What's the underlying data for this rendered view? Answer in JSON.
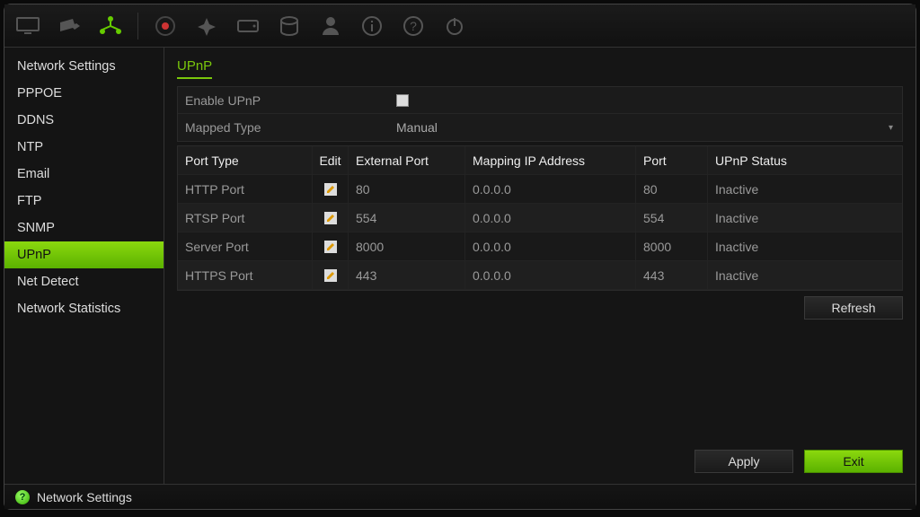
{
  "toolbar_icons": [
    "monitor",
    "camera",
    "network",
    "record",
    "alarm",
    "drive",
    "hdd",
    "user",
    "info",
    "help",
    "power"
  ],
  "sidebar": {
    "items": [
      {
        "label": "Network Settings"
      },
      {
        "label": "PPPOE"
      },
      {
        "label": "DDNS"
      },
      {
        "label": "NTP"
      },
      {
        "label": "Email"
      },
      {
        "label": "FTP"
      },
      {
        "label": "SNMP"
      },
      {
        "label": "UPnP"
      },
      {
        "label": "Net Detect"
      },
      {
        "label": "Network Statistics"
      }
    ],
    "active_index": 7
  },
  "page": {
    "title": "UPnP",
    "enable_label": "Enable UPnP",
    "enable_checked": false,
    "mapped_type_label": "Mapped Type",
    "mapped_type_value": "Manual"
  },
  "table": {
    "headers": {
      "port_type": "Port Type",
      "edit": "Edit",
      "external_port": "External Port",
      "mapping_ip": "Mapping IP Address",
      "port": "Port",
      "status": "UPnP Status"
    },
    "rows": [
      {
        "port_type": "HTTP Port",
        "external_port": "80",
        "mapping_ip": "0.0.0.0",
        "port": "80",
        "status": "Inactive"
      },
      {
        "port_type": "RTSP Port",
        "external_port": "554",
        "mapping_ip": "0.0.0.0",
        "port": "554",
        "status": "Inactive"
      },
      {
        "port_type": "Server Port",
        "external_port": "8000",
        "mapping_ip": "0.0.0.0",
        "port": "8000",
        "status": "Inactive"
      },
      {
        "port_type": "HTTPS Port",
        "external_port": "443",
        "mapping_ip": "0.0.0.0",
        "port": "443",
        "status": "Inactive"
      }
    ]
  },
  "buttons": {
    "refresh": "Refresh",
    "apply": "Apply",
    "exit": "Exit"
  },
  "footer": {
    "label": "Network Settings"
  },
  "colors": {
    "accent": "#7ac70c",
    "bg": "#151515"
  }
}
